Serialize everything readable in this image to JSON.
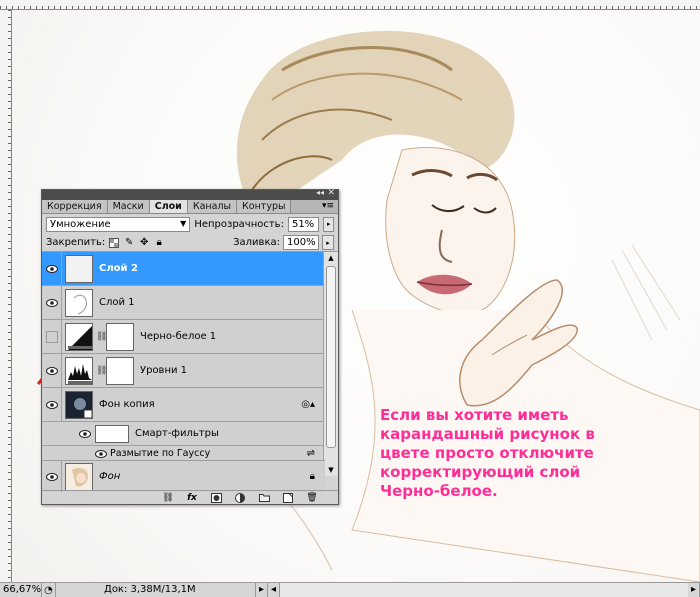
{
  "panel": {
    "tabs": [
      "Коррекция",
      "Маски",
      "Слои",
      "Каналы",
      "Контуры"
    ],
    "active_tab": "Слои",
    "blend_mode": "Умножение",
    "opacity_label": "Непрозрачность:",
    "opacity_value": "51%",
    "lock_label": "Закрепить:",
    "fill_label": "Заливка:",
    "fill_value": "100%",
    "layers": [
      {
        "name": "Слой 2",
        "selected": true,
        "visible": true
      },
      {
        "name": "Слой 1",
        "selected": false,
        "visible": true
      },
      {
        "name": "Черно-белое 1",
        "selected": false,
        "visible": false
      },
      {
        "name": "Уровни 1",
        "selected": false,
        "visible": true
      },
      {
        "name": "Фон копия",
        "selected": false,
        "visible": true
      },
      {
        "name": "Смарт-фильтры",
        "selected": false,
        "visible": true
      },
      {
        "name": "Размытие по Гауссу",
        "selected": false,
        "visible": true
      },
      {
        "name": "Фон",
        "selected": false,
        "visible": true
      }
    ]
  },
  "annotation": "Если вы хотите иметь карандашный рисунок в цвете просто отключите корректирующий слой Черно-белое.",
  "status": {
    "zoom": "66,67%",
    "doc": "Док: 3,38M/13,1M"
  },
  "colors": {
    "selection": "#3399ff",
    "annotation": "#ff2e97",
    "arrow": "#e8262b"
  }
}
